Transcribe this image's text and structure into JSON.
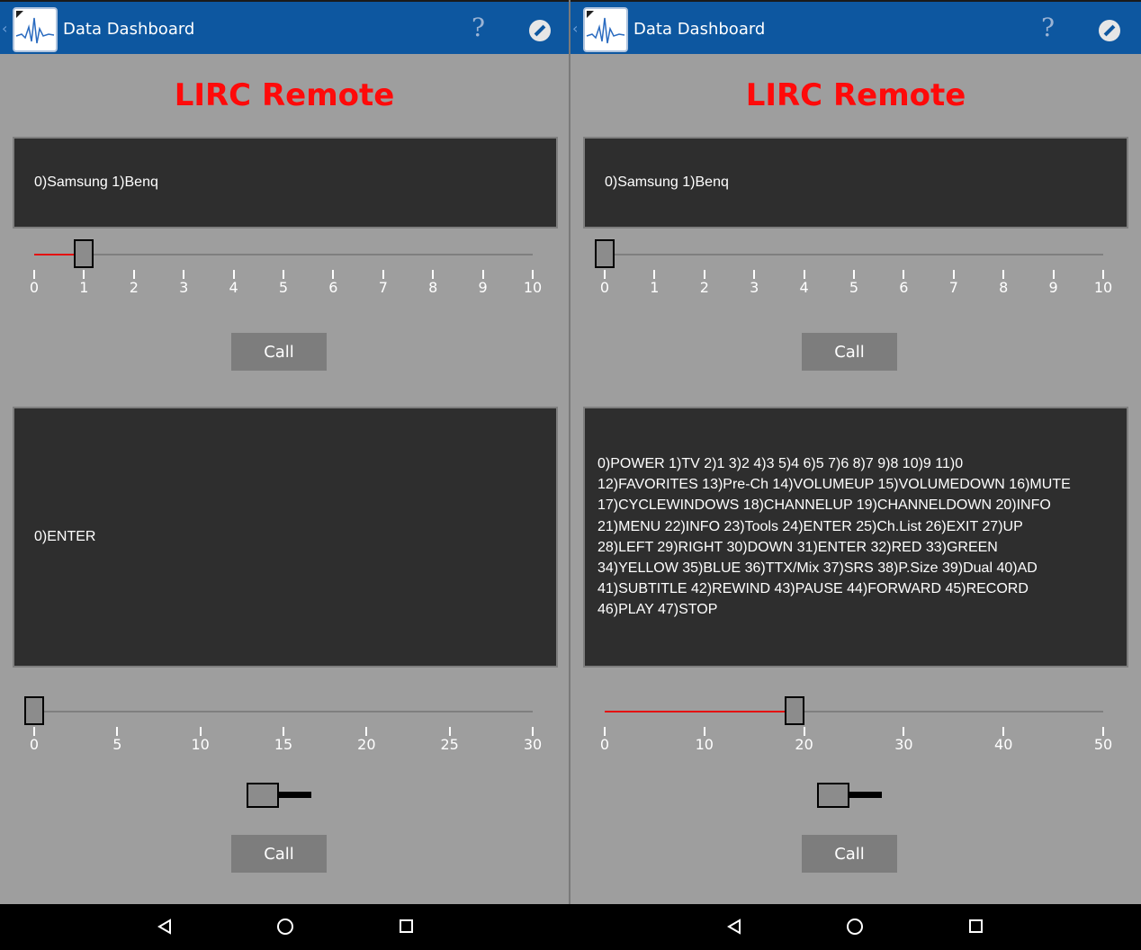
{
  "app": {
    "title": "Data Dashboard",
    "page_title": "LIRC Remote",
    "back_glyph": "‹",
    "help_glyph": "?",
    "icons": [
      "app-icon",
      "help-icon",
      "edit-icon"
    ]
  },
  "left": {
    "device_panel_text": "0)Samsung  1)Benq",
    "device_slider": {
      "min": 0,
      "max": 10,
      "value": 1,
      "ticks": [
        "0",
        "1",
        "2",
        "3",
        "4",
        "5",
        "6",
        "7",
        "8",
        "9",
        "10"
      ]
    },
    "call_label_1": "Call",
    "command_panel_text": "0)ENTER",
    "command_slider": {
      "min": 0,
      "max": 30,
      "value": 0,
      "ticks": [
        "0",
        "5",
        "10",
        "15",
        "20",
        "25",
        "30"
      ]
    },
    "call_label_2": "Call"
  },
  "right": {
    "device_panel_text": "0)Samsung  1)Benq",
    "device_slider": {
      "min": 0,
      "max": 10,
      "value": 0,
      "ticks": [
        "0",
        "1",
        "2",
        "3",
        "4",
        "5",
        "6",
        "7",
        "8",
        "9",
        "10"
      ]
    },
    "call_label_1": "Call",
    "command_panel_text": "0)POWER  1)TV  2)1  3)2  4)3  5)4  6)5  7)6  8)7  9)8  10)9  11)0\n12)FAVORITES  13)Pre-Ch  14)VOLUMEUP  15)VOLUMEDOWN  16)MUTE\n17)CYCLEWINDOWS  18)CHANNELUP  19)CHANNELDOWN  20)INFO\n21)MENU  22)INFO  23)Tools  24)ENTER  25)Ch.List  26)EXIT  27)UP\n28)LEFT  29)RIGHT  30)DOWN  31)ENTER  32)RED  33)GREEN\n34)YELLOW  35)BLUE  36)TTX/Mix  37)SRS  38)P.Size  39)Dual  40)AD\n41)SUBTITLE  42)REWIND  43)PAUSE  44)FORWARD  45)RECORD\n46)PLAY  47)STOP",
    "command_slider": {
      "min": 0,
      "max": 50,
      "value": 19,
      "ticks": [
        "0",
        "10",
        "20",
        "30",
        "40",
        "50"
      ]
    },
    "call_label_2": "Call"
  },
  "colors": {
    "appbar": "#0d57a0",
    "background": "#9e9e9e",
    "panel": "#2e2e2e",
    "title_red": "#ff0a0a",
    "slider_fill": "#e41010"
  },
  "navbar_icons": [
    "back-icon",
    "home-icon",
    "recents-icon"
  ]
}
